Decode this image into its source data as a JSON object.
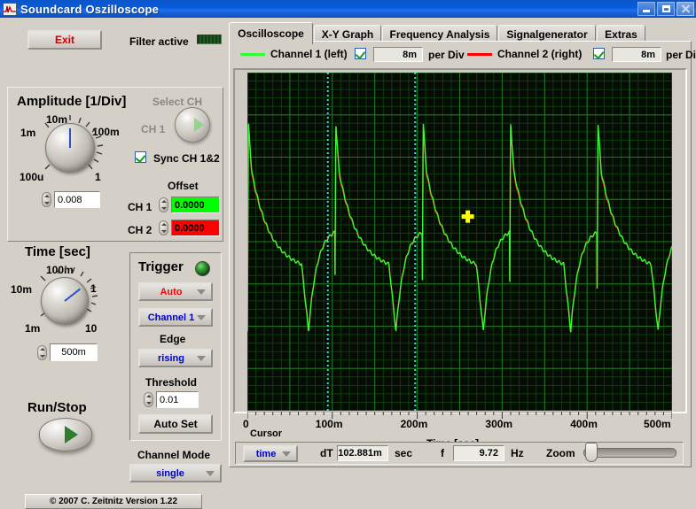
{
  "window": {
    "title": "Soundcard Oszilloscope",
    "icon": "waveform-icon",
    "minimize_label": "minimize-icon",
    "maximize_label": "maximize-icon",
    "close_label": "close-icon"
  },
  "toolbar": {
    "exit_label": "Exit",
    "filter_label": "Filter active",
    "filter_state": "active"
  },
  "amplitude": {
    "title": "Amplitude [1/Div]",
    "knob_labels": [
      "1m",
      "10m",
      "100m",
      "1",
      "100u"
    ],
    "value": "0.008",
    "select_ch_label": "Select CH",
    "select_ch_value": "CH 1",
    "sync_label": "Sync CH 1&2",
    "sync_checked": true,
    "offset_title": "Offset",
    "offsets": [
      {
        "label": "CH 1",
        "value": "0.0000",
        "color": "#00ff00"
      },
      {
        "label": "CH 2",
        "value": "0.0000",
        "color": "#ff0000"
      }
    ]
  },
  "time": {
    "title": "Time [sec]",
    "knob_labels": [
      "10m",
      "100m",
      "1",
      "10",
      "1m"
    ],
    "value": "500m"
  },
  "trigger": {
    "title": "Trigger",
    "led_state": "on",
    "mode": "Auto",
    "mode_color": "#ff0000",
    "source": "Channel 1",
    "source_color": "#0000d0",
    "edge_label": "Edge",
    "edge": "rising",
    "edge_color": "#0000d0",
    "threshold_label": "Threshold",
    "threshold": "0.01",
    "autoset_label": "Auto Set"
  },
  "run": {
    "label": "Run/Stop"
  },
  "channel_mode": {
    "label": "Channel Mode",
    "value": "single",
    "value_color": "#0000d0"
  },
  "footer": {
    "copyright": "© 2007  C. Zeitnitz Version 1.22"
  },
  "tabs": [
    {
      "label": "Oscilloscope",
      "active": true
    },
    {
      "label": "X-Y Graph",
      "active": false
    },
    {
      "label": "Frequency Analysis",
      "active": false
    },
    {
      "label": "Signalgenerator",
      "active": false
    },
    {
      "label": "Extras",
      "active": false
    }
  ],
  "channels": [
    {
      "name": "Channel 1 (left)",
      "color": "#32ff32",
      "enabled": true,
      "per_div_value": "8m",
      "per_div_label": "per Div"
    },
    {
      "name": "Channel 2 (right)",
      "color": "#ff0000",
      "enabled": true,
      "per_div_value": "8m",
      "per_div_label": "per Div"
    }
  ],
  "cursor_bar": {
    "cursor_label": "Cursor",
    "cursor_mode": "time",
    "cursor_mode_color": "#0000d0",
    "dt_label": "dT",
    "dt_value": "102.881m",
    "dt_unit": "sec",
    "f_label": "f",
    "f_value": "9.72",
    "f_unit": "Hz",
    "zoom_label": "Zoom",
    "zoom_value": 2
  },
  "chart_data": {
    "type": "line",
    "title": "",
    "xlabel": "Time [sec]",
    "ylabel": "",
    "xlim": [
      0,
      0.5
    ],
    "xticks": [
      0,
      0.1,
      0.2,
      0.3,
      0.4,
      0.5
    ],
    "xticklabels": [
      "0",
      "100m",
      "200m",
      "300m",
      "400m",
      "500m"
    ],
    "ylim": [
      -0.064,
      0.064
    ],
    "grid": true,
    "grid_color": "#1f7a1f",
    "minor_grid_color": "#0e3d0e",
    "background": "#040c04",
    "legend_position": "top",
    "cursors": {
      "type": "vertical-dotted",
      "color": "#30e0e0",
      "positions": [
        0.0947,
        0.1976
      ],
      "dt": 0.102881,
      "frequency": 9.72
    },
    "marker": {
      "type": "cross",
      "color": "#ffff00",
      "x": 0.2595,
      "y": 0.0095
    },
    "series": [
      {
        "name": "Channel 1 (left)",
        "color": "#32ff32",
        "volts_per_div": 0.008,
        "waveform": "sawtooth-decay",
        "period": 0.102881,
        "phase_offset": 0.0,
        "peak": 0.0265,
        "trough": -0.034,
        "spike_peak": 0.045
      },
      {
        "name": "Channel 2 (right)",
        "color": "#ff0000",
        "volts_per_div": 0.008,
        "waveform": "sawtooth-decay",
        "period": 0.102881,
        "phase_offset": 0.0,
        "peak": 0.0255,
        "trough": -0.0335,
        "spike_peak": 0.044
      }
    ]
  }
}
